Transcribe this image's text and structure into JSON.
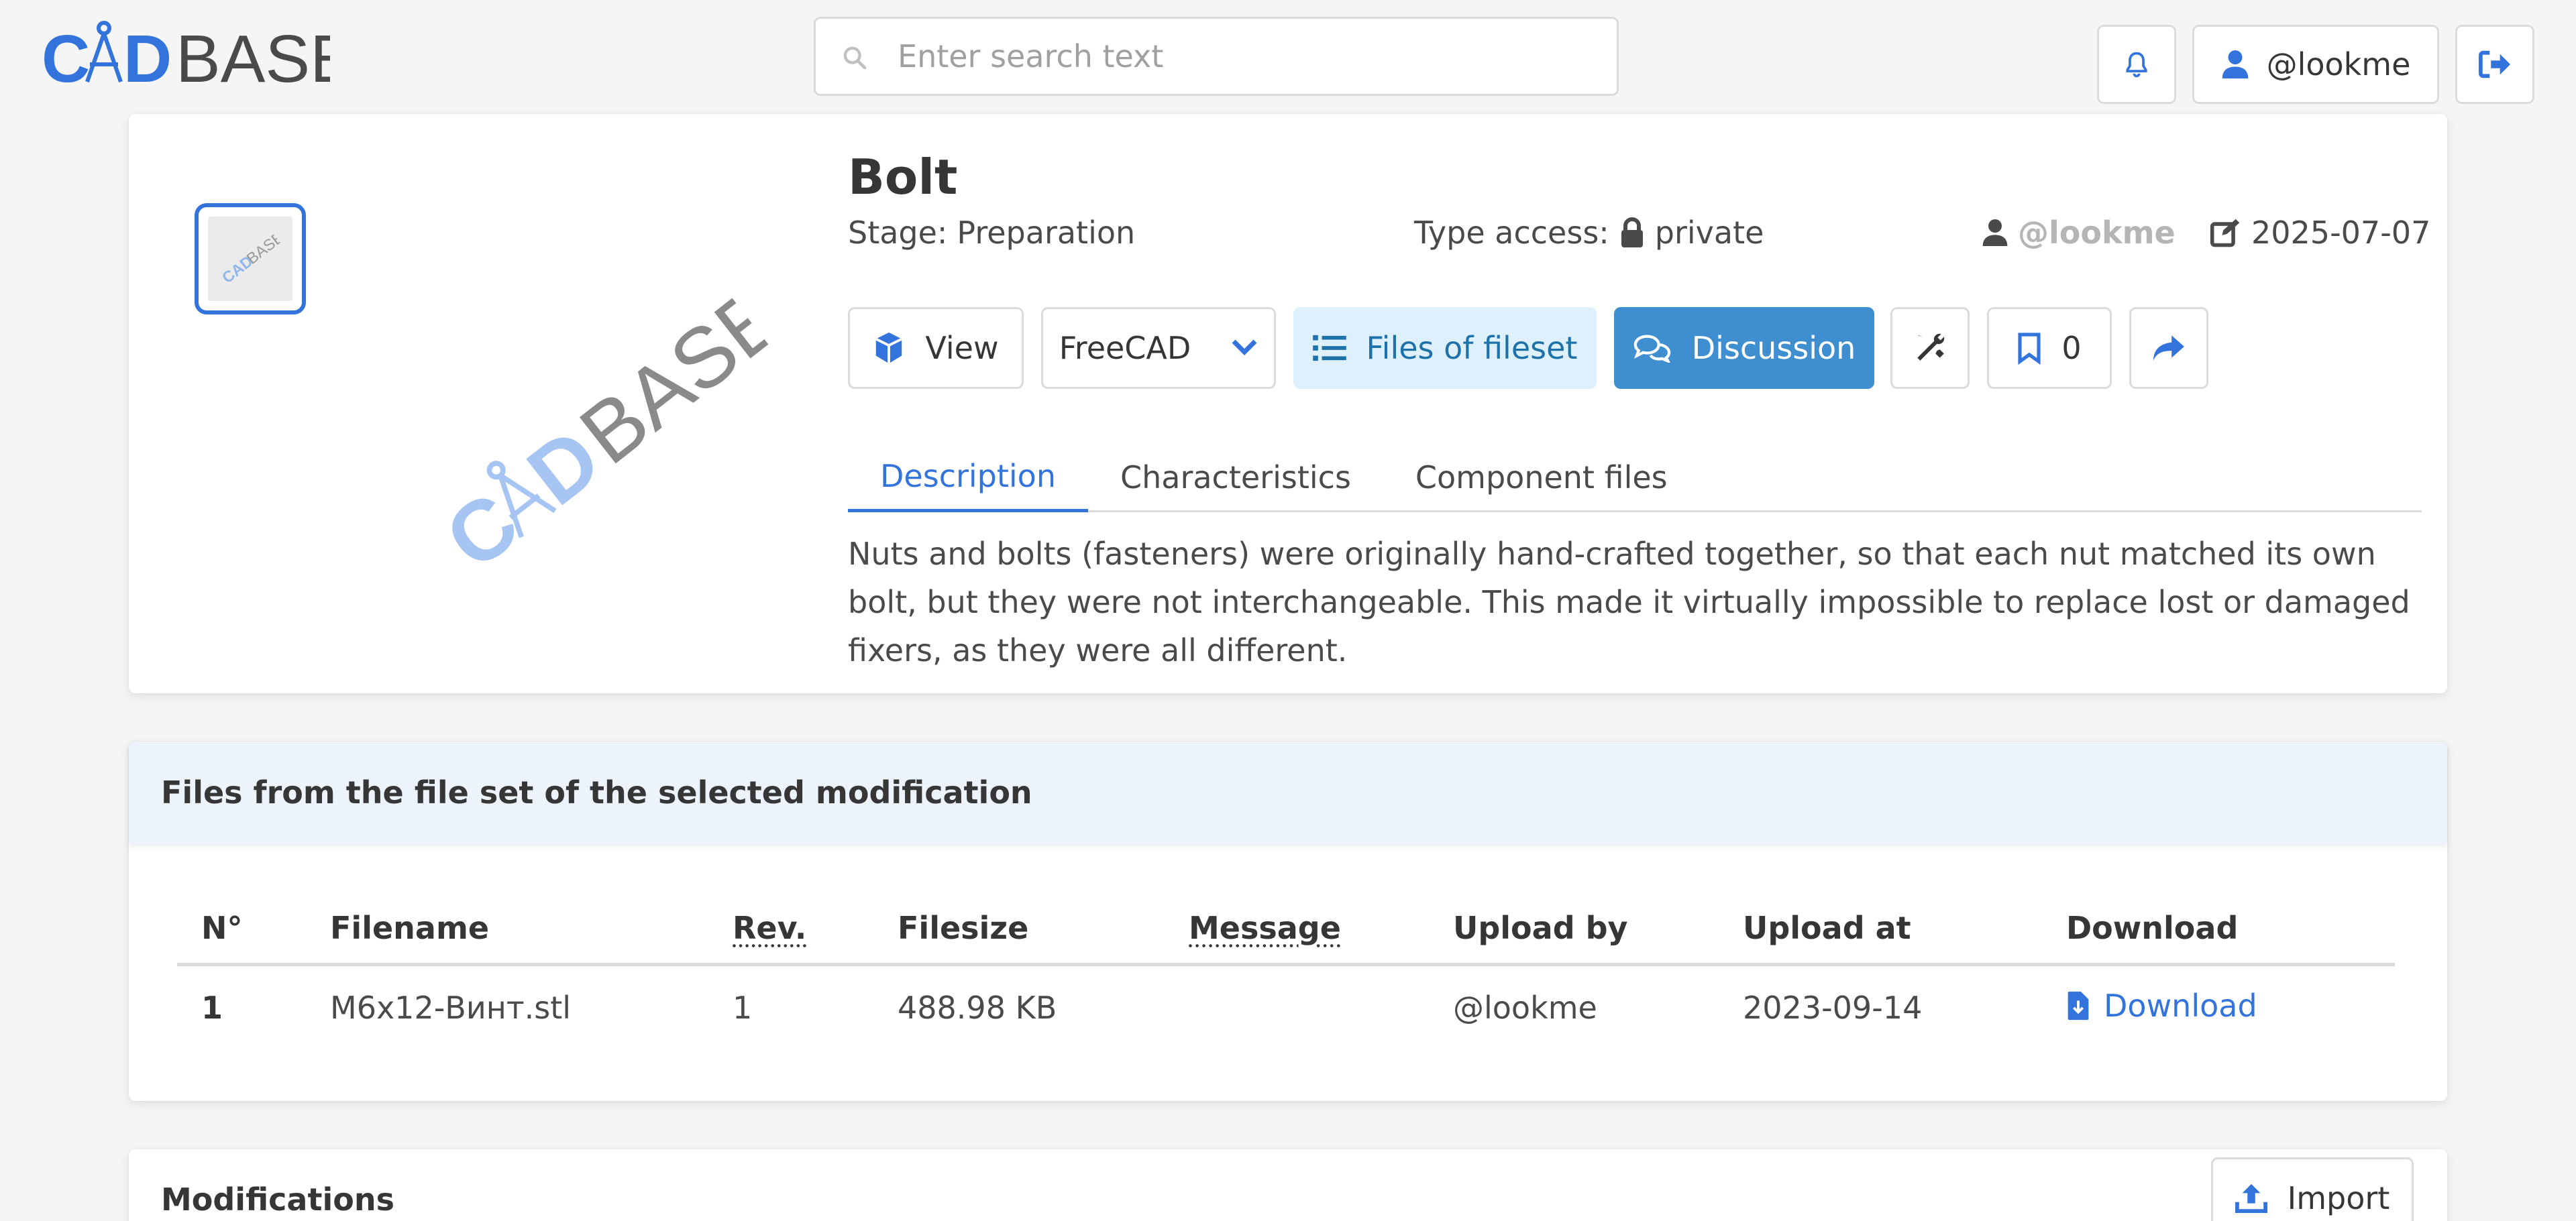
{
  "navbar": {
    "logo_text": "CADBASE",
    "search": {
      "placeholder": "Enter search text",
      "value": ""
    },
    "user_label": "@lookme"
  },
  "component": {
    "title": "Bolt",
    "stage_label": "Stage:",
    "stage_value": "Preparation",
    "access_label": "Type access:",
    "access_value": "private",
    "owner": "@lookme",
    "date": "2025-07-07",
    "buttons": {
      "view": "View",
      "program": "FreeCAD",
      "files": "Files of fileset",
      "discussion": "Discussion",
      "bookmarks": "0"
    },
    "tabs": [
      "Description",
      "Characteristics",
      "Component files"
    ],
    "active_tab": "Description",
    "description": "Nuts and bolts (fasteners) were originally hand-crafted together, so that each nut matched its own bolt, but they were not interchangeable. This made it virtually impossible to replace lost or damaged fixers, as they were all different."
  },
  "files_card": {
    "header": "Files from the file set of the selected modification",
    "columns": [
      "N°",
      "Filename",
      "Rev.",
      "Filesize",
      "Message",
      "Upload by",
      "Upload at",
      "Download"
    ],
    "rows": [
      {
        "num": "1",
        "filename": "M6x12-Винт.stl",
        "rev": "1",
        "size": "488.98 KB",
        "message": "",
        "upload_by": "@lookme",
        "upload_at": "2023-09-14",
        "download": "Download"
      }
    ]
  },
  "modifications_card": {
    "header": "Modifications",
    "import_label": "Import"
  },
  "colors": {
    "primary": "#3273dc",
    "info": "#3e8ed0",
    "info_light": "#def0fb",
    "header_bg": "#ecf3fa",
    "page_bg": "#f5f5f5"
  }
}
